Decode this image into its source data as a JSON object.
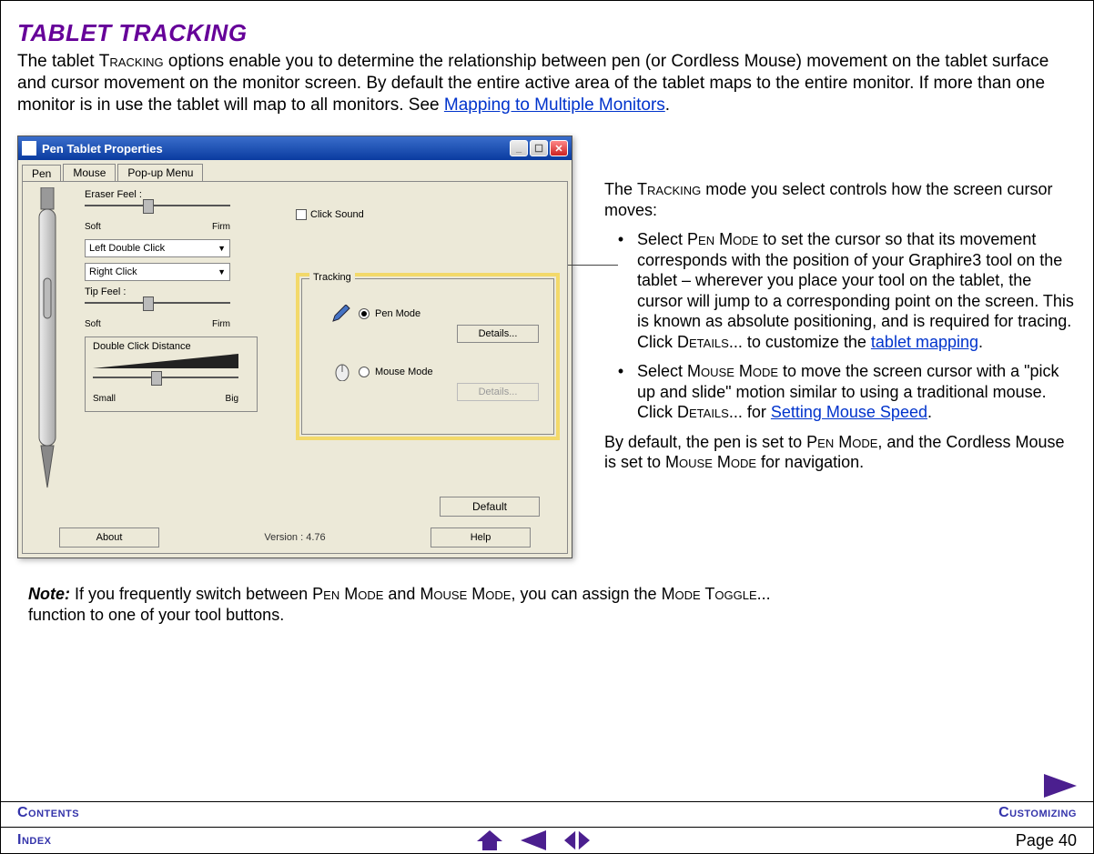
{
  "heading": "TABLET TRACKING",
  "intro": {
    "part1": "The tablet ",
    "tracking_sc": "Tracking",
    "part2": " options enable you to determine the relationship between pen (or Cordless Mouse) movement on the tablet surface and cursor movement on the monitor screen.  By default the entire active area of the tablet maps to the entire monitor.  If more than one monitor is in use the tablet will map to all monitors.  See ",
    "link": "Mapping to Multiple Monitors",
    "part3": "."
  },
  "dialog": {
    "title": "Pen Tablet Properties",
    "tabs": [
      "Pen",
      "Mouse",
      "Pop-up Menu"
    ],
    "eraser_label": "Eraser Feel :",
    "soft": "Soft",
    "firm": "Firm",
    "left_dc": "Left Double Click",
    "right_click": "Right Click",
    "tip_label": "Tip Feel :",
    "dcd_label": "Double Click Distance",
    "small": "Small",
    "big": "Big",
    "click_sound": "Click Sound",
    "tracking_legend": "Tracking",
    "pen_mode": "Pen Mode",
    "mouse_mode": "Mouse Mode",
    "details": "Details...",
    "about": "About",
    "version": "Version : 4.76",
    "help": "Help",
    "default_btn": "Default"
  },
  "side": {
    "p1a": "The ",
    "p1sc": "Tracking",
    "p1b": " mode you select controls how the screen cursor moves:",
    "bullet": "•",
    "li1a": "Select ",
    "li1sc1": "Pen Mode",
    "li1b": " to set the cursor so that its movement corresponds with the position of your Graphire3 tool on the tablet – wherever you place your tool on the tablet, the cursor will jump to a corresponding point on the screen.  This is known as absolute positioning, and is required for tracing.  Click ",
    "li1sc2": "Details",
    "li1c": "... to customize the ",
    "li1link": "tablet mapping",
    "li1d": ".",
    "li2a": "Select ",
    "li2sc1": "Mouse Mode",
    "li2b": " to move the screen cursor with a \"pick up and slide\" motion similar to using a traditional mouse.  Click ",
    "li2sc2": "Details",
    "li2c": "... for ",
    "li2link": "Setting Mouse Speed",
    "li2d": ".",
    "p2a": "By default, the pen is set to ",
    "p2sc1": "Pen Mode",
    "p2b": ", and the Cordless Mouse is set to ",
    "p2sc2": "Mouse Mode",
    "p2c": " for navigation."
  },
  "note": {
    "label": "Note:",
    "part1": " If you frequently switch between ",
    "sc1": "Pen Mode",
    "part2": " and ",
    "sc2": "Mouse Mode",
    "part3": ", you can assign the ",
    "sc3": "Mode Toggle",
    "part4": "... function to one of your tool buttons."
  },
  "footer": {
    "contents": "Contents",
    "customizing": "Customizing",
    "index": "Index",
    "page_label": "Page  40"
  }
}
